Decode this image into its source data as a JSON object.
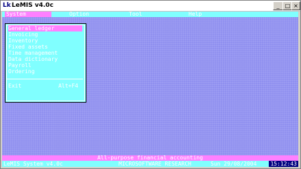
{
  "window": {
    "title": "LeMIS v4.0c",
    "minimize_glyph": "_",
    "maximize_glyph": "□",
    "close_glyph": "×"
  },
  "menubar": {
    "items": [
      {
        "label": "System"
      },
      {
        "label": "Option"
      },
      {
        "label": "Tool"
      },
      {
        "label": "Help"
      }
    ]
  },
  "dropdown": {
    "items": [
      {
        "label": "General ledger"
      },
      {
        "label": "Invoicing"
      },
      {
        "label": "Inventory"
      },
      {
        "label": "Fixed assets"
      },
      {
        "label": "Time management"
      },
      {
        "label": "Data dictionary"
      },
      {
        "label": "Payroll"
      },
      {
        "label": "Ordering"
      }
    ],
    "exit": {
      "label": "Exit",
      "shortcut": "Alt+F4"
    }
  },
  "status_message": "All-purpose financial accounting",
  "statusbar": {
    "app": "LeMIS System v4.0c",
    "company": "MICROSOFTWARE RESEARCH",
    "date": "Sun 29/08/2004",
    "time": "15:12:43"
  },
  "colors": {
    "screen": "#9090f0",
    "cyan": "#80ffff",
    "highlight": "#ff80ff"
  }
}
